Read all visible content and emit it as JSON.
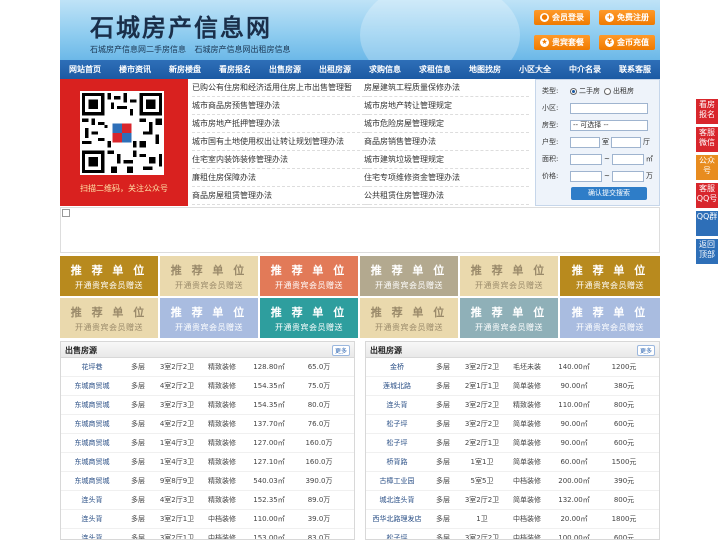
{
  "header": {
    "title": "石城房产信息网",
    "subtitles": [
      "石城房产信息网二手房信息",
      "石城房产信息网出租房信息"
    ],
    "buttons": [
      {
        "label": "会员登录",
        "icon": "user-icon"
      },
      {
        "label": "免费注册",
        "icon": "register-icon"
      },
      {
        "label": "贵宾套餐",
        "icon": "vip-icon"
      },
      {
        "label": "金币充值",
        "icon": "coin-icon"
      }
    ],
    "accent": "#f07a00"
  },
  "nav": [
    "网站首页",
    "楼市资讯",
    "新房楼盘",
    "看房报名",
    "出售房源",
    "出租房源",
    "求购信息",
    "求租信息",
    "地图找房",
    "小区大全",
    "中介名录",
    "联系客服"
  ],
  "qr": {
    "caption": "扫描二维码，关注公众号"
  },
  "news": {
    "left": [
      "已购公有住房和经济适用住房上市出售管理暂",
      "城市商品房预售管理办法",
      "城市房地产抵押管理办法",
      "城市国有土地使用权出让转让规划管理办法",
      "住宅室内装饰装修管理办法",
      "廉租住房保障办法",
      "商品房屋租赁管理办法"
    ],
    "right": [
      "房屋建筑工程质量保修办法",
      "城市房地产转让管理规定",
      "城市危险房屋管理规定",
      "商品房销售管理办法",
      "城市建筑垃圾管理规定",
      "住宅专项维修资金管理办法",
      "公共租赁住房管理办法"
    ]
  },
  "search": {
    "type_label": "类型:",
    "type_options": [
      "二手房",
      "出租房"
    ],
    "community_label": "小区:",
    "house_type_label": "房型:",
    "house_type_value": "-- 可选择 --",
    "layout_label": "户型:",
    "room_unit": "室",
    "hall_unit": "厅",
    "area_label": "面积:",
    "area_unit": "㎡",
    "price_label": "价格:",
    "price_unit": "万",
    "submit": "确认提交搜索"
  },
  "tiles": {
    "title": "推 荐 单 位",
    "subtitle": "开通贵宾会员赠送",
    "colors": [
      "#b88a1e",
      "#ead9ad",
      "#e27a58",
      "#b3a98f",
      "#ead9ad",
      "#b88a1e",
      "#ead9ad",
      "#a9bce0",
      "#2e9e9e",
      "#ead9ad",
      "#8fb0b8",
      "#a9bce0"
    ]
  },
  "sale": {
    "title": "出售房源",
    "more": "更多",
    "rows": [
      [
        "花坪巷",
        "多层",
        "3室2厅2卫",
        "精致装修",
        "128.80㎡",
        "65.0万"
      ],
      [
        "东城商贸城",
        "多层",
        "4室2厅2卫",
        "精致装修",
        "154.35㎡",
        "75.0万"
      ],
      [
        "东城商贸城",
        "多层",
        "3室2厅3卫",
        "精致装修",
        "154.35㎡",
        "80.0万"
      ],
      [
        "东城商贸城",
        "多层",
        "4室2厅2卫",
        "精致装修",
        "137.70㎡",
        "76.0万"
      ],
      [
        "东城商贸城",
        "多层",
        "1室4厅3卫",
        "精致装修",
        "127.00㎡",
        "160.0万"
      ],
      [
        "东城商贸城",
        "多层",
        "1室4厅3卫",
        "精致装修",
        "127.10㎡",
        "160.0万"
      ],
      [
        "东城商贸城",
        "多层",
        "9室8厅9卫",
        "精致装修",
        "540.03㎡",
        "390.0万"
      ],
      [
        "连头背",
        "多层",
        "4室2厅3卫",
        "精致装修",
        "152.35㎡",
        "89.0万"
      ],
      [
        "连头背",
        "多层",
        "3室2厅1卫",
        "中档装修",
        "110.00㎡",
        "39.0万"
      ],
      [
        "连头背",
        "多层",
        "3室2厅1卫",
        "中档装修",
        "153.00㎡",
        "83.0万"
      ]
    ]
  },
  "rent": {
    "title": "出租房源",
    "more": "更多",
    "rows": [
      [
        "金桥",
        "多层",
        "3室2厅2卫",
        "毛坯未装",
        "140.00㎡",
        "1200元"
      ],
      [
        "莲城北路",
        "多层",
        "2室1厅1卫",
        "简单装修",
        "90.00㎡",
        "380元"
      ],
      [
        "连头背",
        "多层",
        "3室2厅2卫",
        "精致装修",
        "110.00㎡",
        "800元"
      ],
      [
        "松子坪",
        "多层",
        "3室2厅2卫",
        "简单装修",
        "90.00㎡",
        "600元"
      ],
      [
        "松子坪",
        "多层",
        "2室2厅1卫",
        "简单装修",
        "90.00㎡",
        "600元"
      ],
      [
        "桥背路",
        "多层",
        "1室1卫",
        "简单装修",
        "60.00㎡",
        "1500元"
      ],
      [
        "古樟工业园",
        "多层",
        "5室5卫",
        "中档装修",
        "200.00㎡",
        "390元"
      ],
      [
        "城北连头背",
        "多层",
        "3室2厅2卫",
        "简单装修",
        "132.00㎡",
        "800元"
      ],
      [
        "西华北路理发店",
        "多层",
        "1卫",
        "中档装修",
        "20.00㎡",
        "1800元"
      ],
      [
        "松子坪",
        "多层",
        "3室2厅2卫",
        "中档装修",
        "100.00㎡",
        "600元"
      ]
    ]
  },
  "float": [
    {
      "label": "看房报名",
      "color": "#d8262c"
    },
    {
      "label": "客服微信",
      "color": "#d8262c"
    },
    {
      "label": "公众号",
      "color": "#e88c1f"
    },
    {
      "label": "客服QQ号",
      "color": "#d8262c"
    },
    {
      "label": "QQ群",
      "color": "#2e6fb8"
    },
    {
      "label": "返回顶部",
      "color": "#2e6fb8"
    }
  ]
}
